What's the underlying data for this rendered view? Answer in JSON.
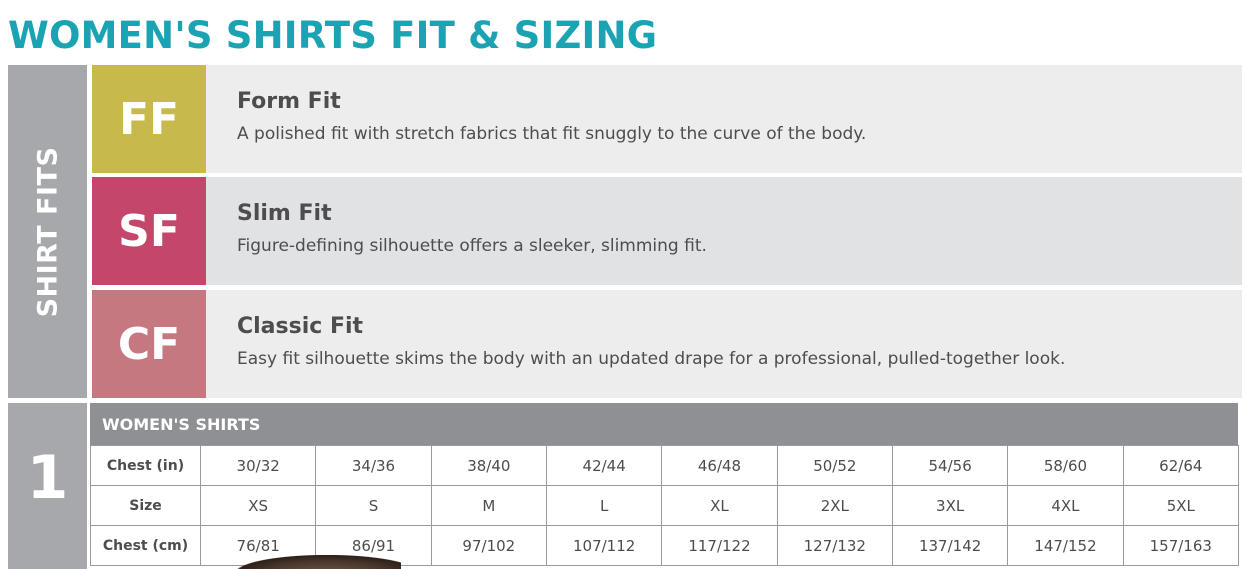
{
  "page": {
    "title": "WOMEN'S SHIRTS FIT & SIZING"
  },
  "fits_section": {
    "label": "SHIRT FITS",
    "fits": [
      {
        "code": "FF",
        "name": "Form Fit",
        "description": "A polished fit with stretch fabrics that fit snuggly to the curve of the body.",
        "color": "#c7b94b",
        "row_bg": "#ededed"
      },
      {
        "code": "SF",
        "name": "Slim Fit",
        "description": "Figure-defining silhouette offers a sleeker, slimming fit.",
        "color": "#c4476b",
        "row_bg": "#e1e2e3"
      },
      {
        "code": "CF",
        "name": "Classic Fit",
        "description": "Easy fit silhouette skims the body with an updated drape for a professional, pulled-together look.",
        "color": "#c67880",
        "row_bg": "#ededed"
      }
    ]
  },
  "size_section": {
    "label": "1",
    "table_title": "WOMEN'S SHIRTS",
    "rows": [
      {
        "label": "Chest (in)",
        "values": [
          "30/32",
          "34/36",
          "38/40",
          "42/44",
          "46/48",
          "50/52",
          "54/56",
          "58/60",
          "62/64"
        ]
      },
      {
        "label": "Size",
        "values": [
          "XS",
          "S",
          "M",
          "L",
          "XL",
          "2XL",
          "3XL",
          "4XL",
          "5XL"
        ]
      },
      {
        "label": "Chest (cm)",
        "values": [
          "76/81",
          "86/91",
          "97/102",
          "107/112",
          "117/122",
          "127/132",
          "137/142",
          "147/152",
          "157/163"
        ]
      }
    ]
  },
  "colors": {
    "title": "#1ba3b3",
    "side_panel": "#a7a8ab",
    "table_header": "#8f9093"
  }
}
